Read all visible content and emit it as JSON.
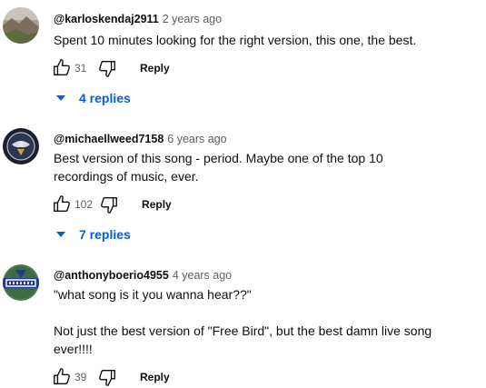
{
  "comments": [
    {
      "author": "@karloskendaj2911",
      "time": "2 years ago",
      "text": "Spent 10 minutes looking for the right version, this one, the best.",
      "likes": "31",
      "reply_label": "Reply",
      "replies_label": "4 replies"
    },
    {
      "author": "@michaellweed7158",
      "time": "6 years ago",
      "text": "Best version of this song - period. Maybe one of the top 10\nrecordings of music, ever.",
      "likes": "102",
      "reply_label": "Reply",
      "replies_label": "7 replies"
    },
    {
      "author": "@anthonyboerio4955",
      "time": "4 years ago",
      "text": "\"what song is it you wanna hear??\"\n\nNot just the best version of \"Free Bird\", but the best damn live song\never!!!!",
      "likes": "39",
      "reply_label": "Reply"
    }
  ],
  "icons": {
    "like": "thumb-up-outline",
    "dislike": "thumb-down-outline",
    "expand": "caret-down"
  },
  "colors": {
    "link_blue": "#065fd4",
    "secondary_text": "#606060",
    "primary_text": "#0f0f0f"
  }
}
